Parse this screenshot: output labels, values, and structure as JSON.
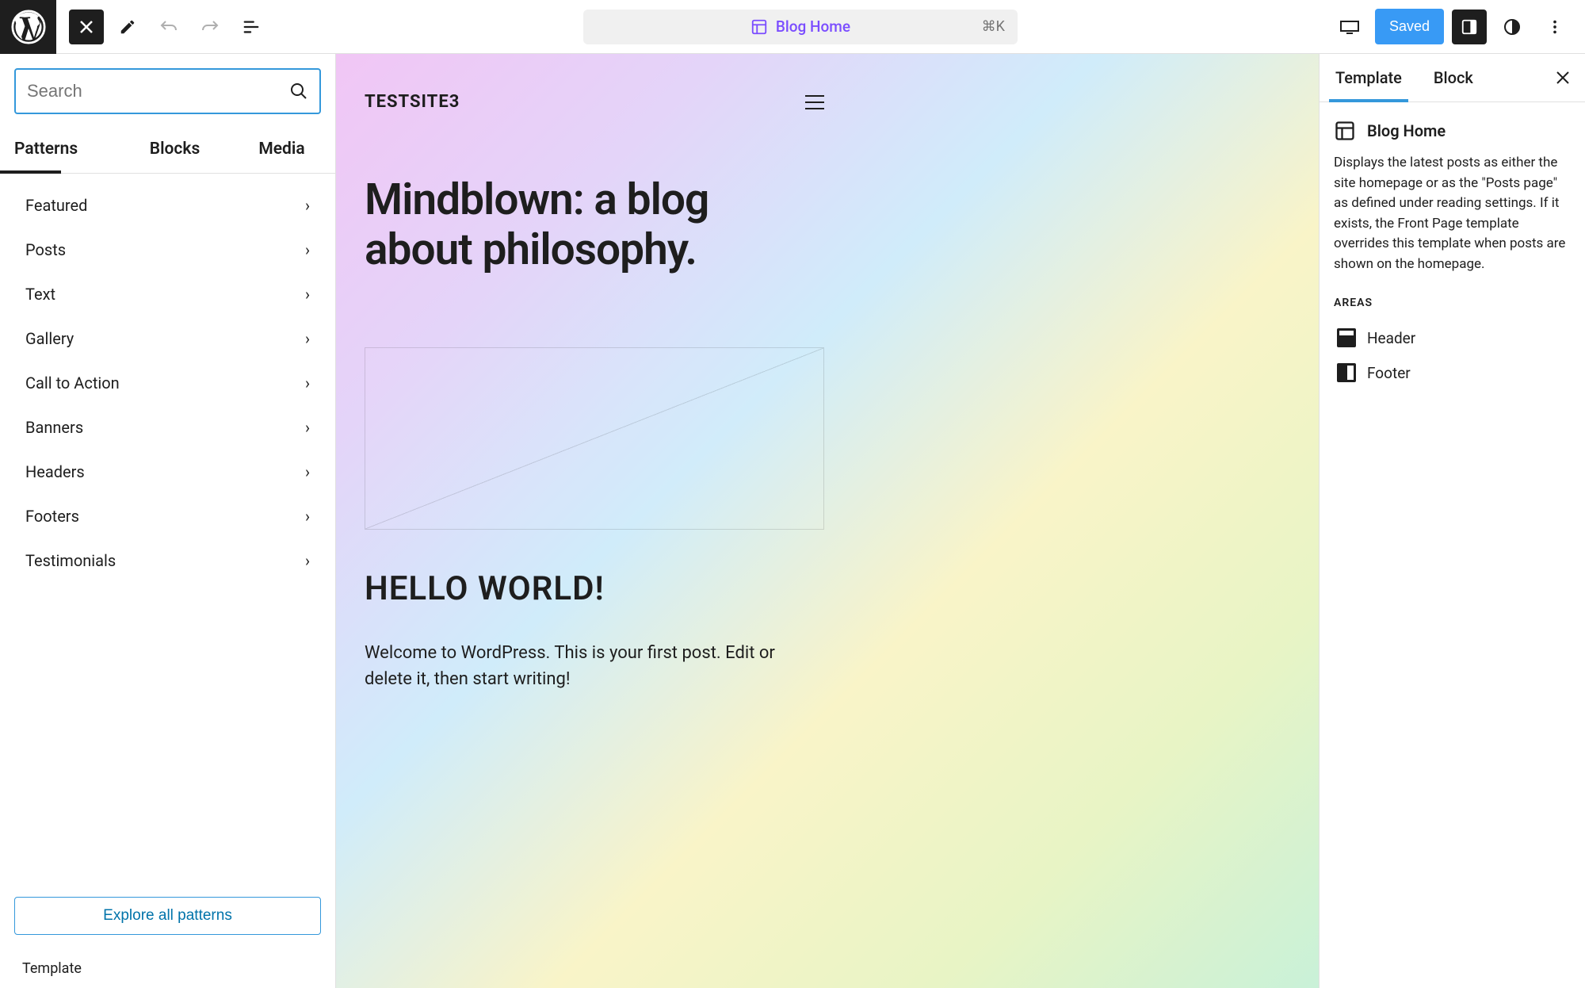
{
  "topbar": {
    "doc_title": "Blog Home",
    "kbd": "⌘K",
    "saved_label": "Saved"
  },
  "left": {
    "search_placeholder": "Search",
    "tabs": {
      "patterns": "Patterns",
      "blocks": "Blocks",
      "media": "Media"
    },
    "categories": [
      "Featured",
      "Posts",
      "Text",
      "Gallery",
      "Call to Action",
      "Banners",
      "Headers",
      "Footers",
      "Testimonials"
    ],
    "explore": "Explore all patterns",
    "bottom": "Template"
  },
  "canvas": {
    "site_title": "TESTSITE3",
    "headline": "Mindblown: a blog about philosophy.",
    "post_title": "HELLO WORLD!",
    "post_body": "Welcome to WordPress. This is your first post. Edit or delete it, then start writing!"
  },
  "right": {
    "tabs": {
      "template": "Template",
      "block": "Block"
    },
    "title": "Blog Home",
    "desc": "Displays the latest posts as either the site homepage or as the \"Posts page\" as defined under reading settings. If it exists, the Front Page template overrides this template when posts are shown on the homepage.",
    "areas_label": "AREAS",
    "areas": {
      "header": "Header",
      "footer": "Footer"
    }
  }
}
